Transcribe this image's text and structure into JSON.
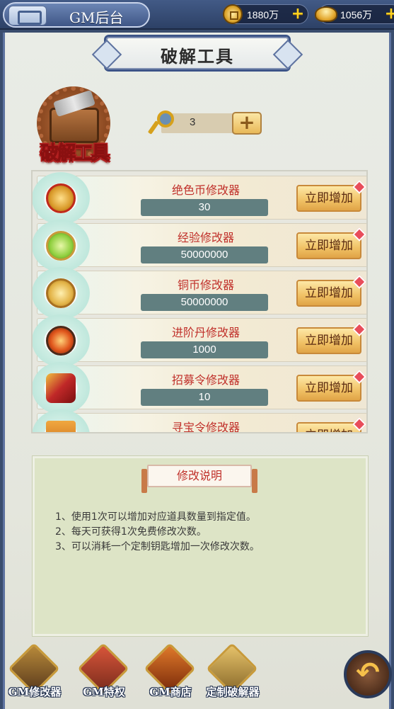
{
  "header": {
    "tab_title": "GM后台",
    "currency_1": {
      "icon": "coin-icon",
      "value": "1880万"
    },
    "currency_2": {
      "icon": "ingot-icon",
      "value": "1056万"
    }
  },
  "panel": {
    "title": "破解工具",
    "toolbox_label": "破解工具",
    "key_count": "3"
  },
  "items": [
    {
      "name": "绝色币修改器",
      "value": "30",
      "button": "立即增加",
      "icon_color": "#d93a2a"
    },
    {
      "name": "经验修改器",
      "value": "50000000",
      "button": "立即增加",
      "icon_color": "#7bbf3c"
    },
    {
      "name": "铜币修改器",
      "value": "50000000",
      "button": "立即增加",
      "icon_color": "#d9a535"
    },
    {
      "name": "进阶丹修改器",
      "value": "1000",
      "button": "立即增加",
      "icon_color": "#e04c1c"
    },
    {
      "name": "招募令修改器",
      "value": "10",
      "button": "立即增加",
      "icon_color": "#c02828"
    },
    {
      "name": "寻宝令修改器",
      "value": "",
      "button": "立即增加",
      "icon_color": "#e08a1c"
    }
  ],
  "description": {
    "title": "修改说明",
    "lines": [
      "1、使用1次可以增加对应道具数量到指定值。",
      "2、每天可获得1次免费修改次数。",
      "3、可以消耗一个定制钥匙增加一次修改次数。"
    ]
  },
  "nav": {
    "items": [
      {
        "label": "GM修改器"
      },
      {
        "label": "GM特权"
      },
      {
        "label": "GM商店"
      },
      {
        "label": "定制破解器"
      }
    ]
  }
}
